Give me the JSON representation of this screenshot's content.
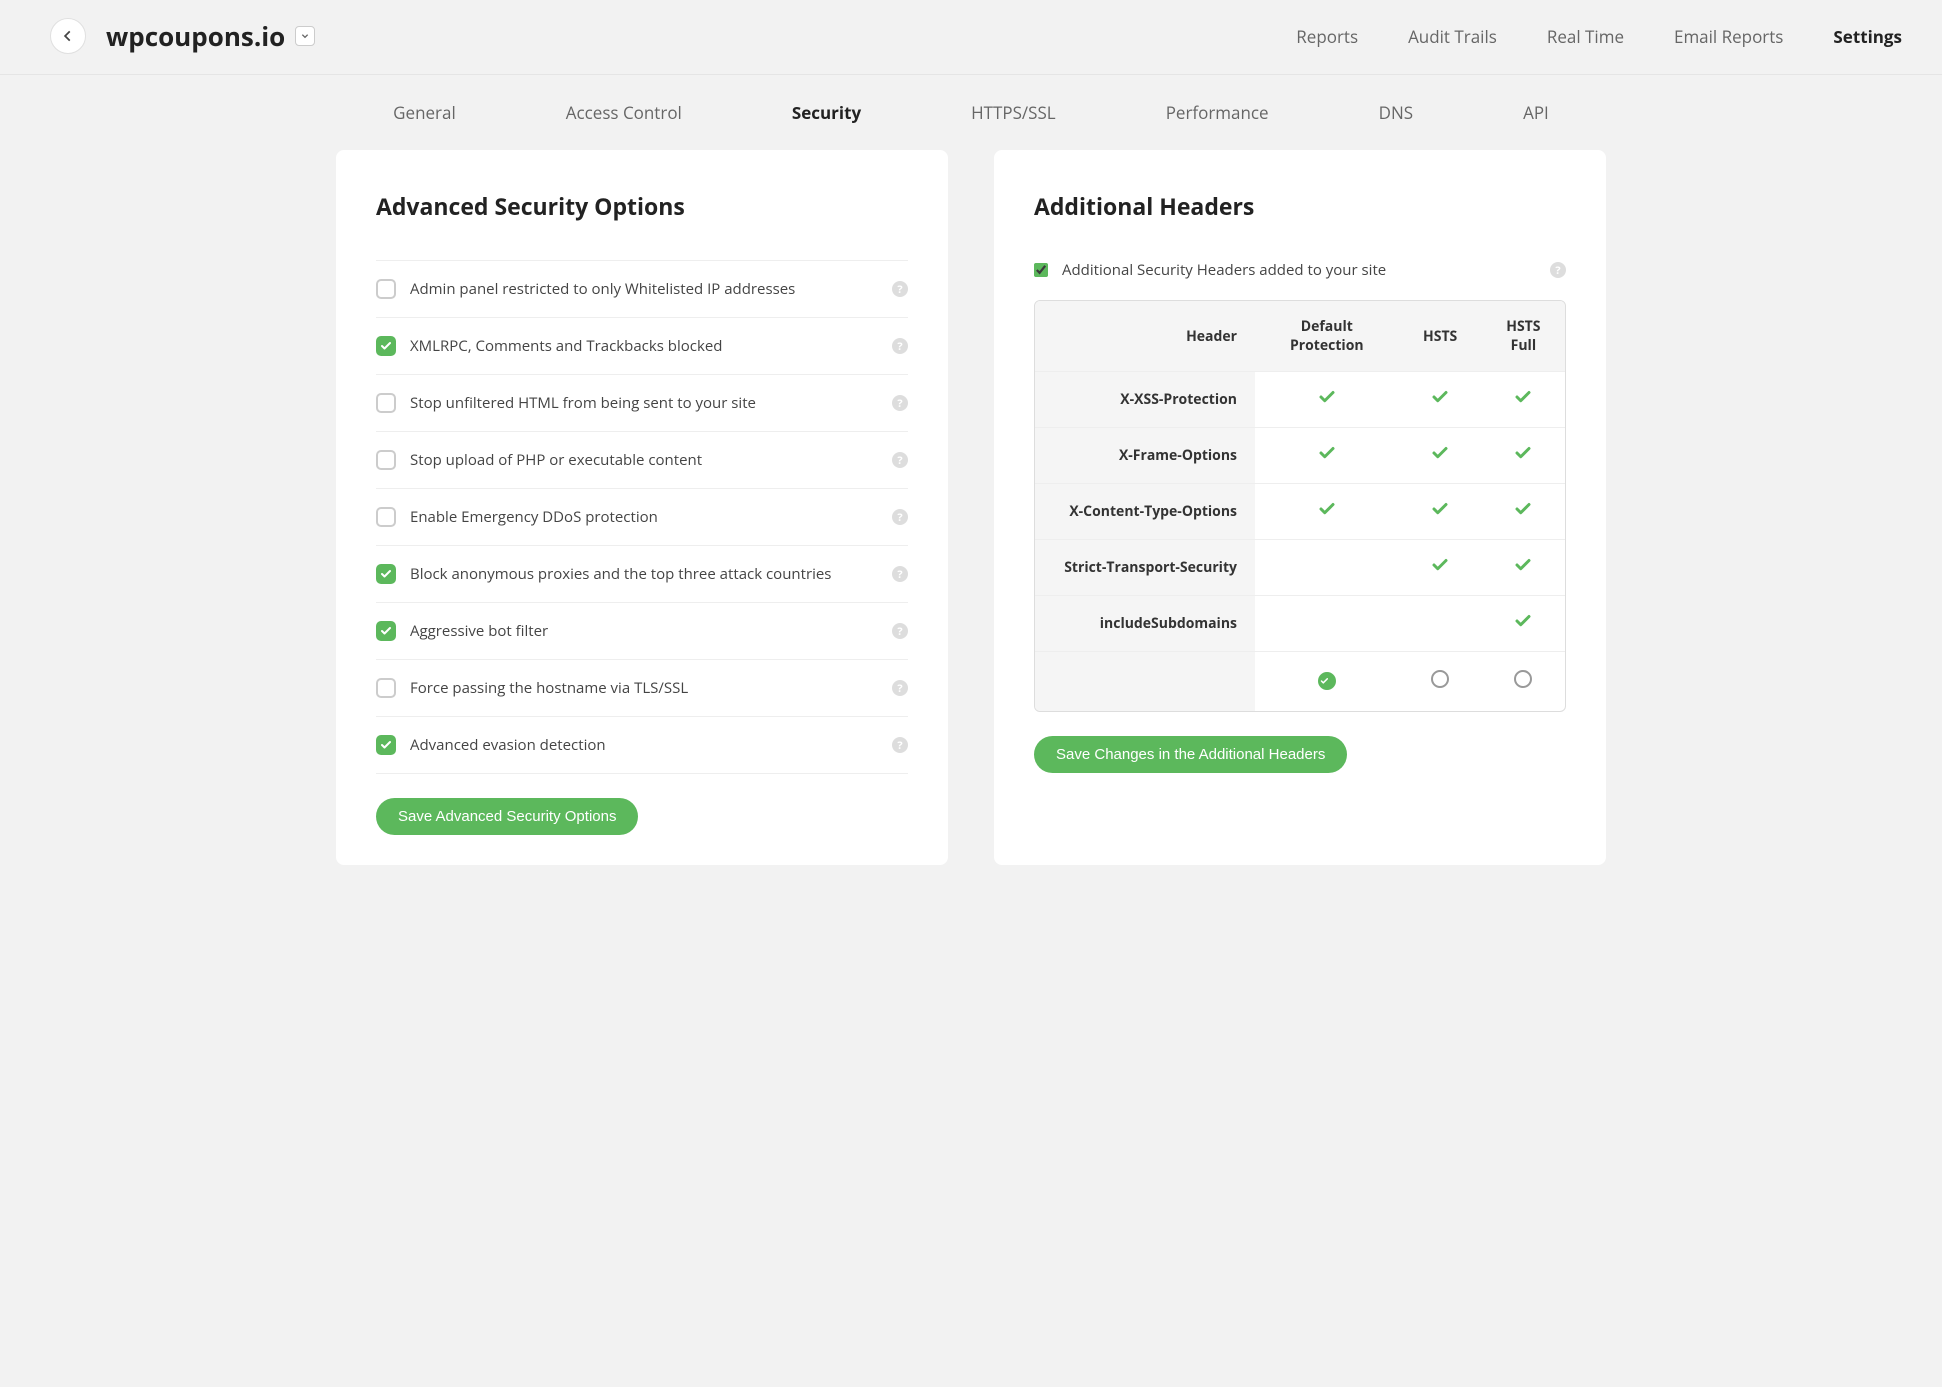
{
  "header": {
    "site_title": "wpcoupons.io",
    "topnav": [
      {
        "label": "Reports",
        "active": false
      },
      {
        "label": "Audit Trails",
        "active": false
      },
      {
        "label": "Real Time",
        "active": false
      },
      {
        "label": "Email Reports",
        "active": false
      },
      {
        "label": "Settings",
        "active": true
      }
    ]
  },
  "subnav": [
    {
      "label": "General",
      "active": false
    },
    {
      "label": "Access Control",
      "active": false
    },
    {
      "label": "Security",
      "active": true
    },
    {
      "label": "HTTPS/SSL",
      "active": false
    },
    {
      "label": "Performance",
      "active": false
    },
    {
      "label": "DNS",
      "active": false
    },
    {
      "label": "API",
      "active": false
    }
  ],
  "security": {
    "title": "Advanced Security Options",
    "options": [
      {
        "label": "Admin panel restricted to only Whitelisted IP addresses",
        "checked": false
      },
      {
        "label": "XMLRPC, Comments and Trackbacks blocked",
        "checked": true
      },
      {
        "label": "Stop unfiltered HTML from being sent to your site",
        "checked": false
      },
      {
        "label": "Stop upload of PHP or executable content",
        "checked": false
      },
      {
        "label": "Enable Emergency DDoS protection",
        "checked": false
      },
      {
        "label": "Block anonymous proxies and the top three attack countries",
        "checked": true
      },
      {
        "label": "Aggressive bot filter",
        "checked": true
      },
      {
        "label": "Force passing the hostname via TLS/SSL",
        "checked": false
      },
      {
        "label": "Advanced evasion detection",
        "checked": true
      }
    ],
    "save_label": "Save Advanced Security Options"
  },
  "headers": {
    "title": "Additional Headers",
    "toggle_label": "Additional Security Headers added to your site",
    "toggle_checked": true,
    "columns": [
      "Header",
      "Default Protection",
      "HSTS",
      "HSTS Full"
    ],
    "rows": [
      {
        "name": "X-XSS-Protection",
        "values": [
          true,
          true,
          true
        ]
      },
      {
        "name": "X-Frame-Options",
        "values": [
          true,
          true,
          true
        ]
      },
      {
        "name": "X-Content-Type-Options",
        "values": [
          true,
          true,
          true
        ]
      },
      {
        "name": "Strict-Transport-Security",
        "values": [
          false,
          true,
          true
        ]
      },
      {
        "name": "includeSubdomains",
        "values": [
          false,
          false,
          true
        ]
      }
    ],
    "selected_column": 0,
    "save_label": "Save Changes in the Additional Headers"
  }
}
